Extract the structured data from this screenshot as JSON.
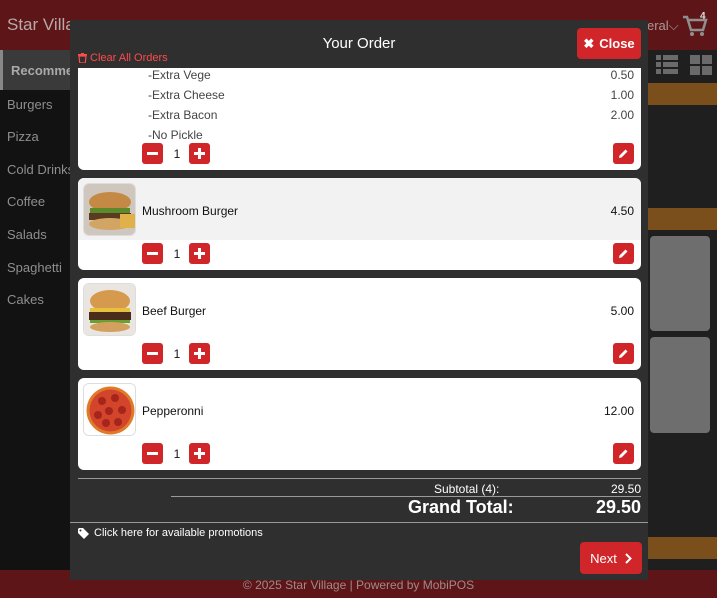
{
  "app": {
    "brand": "Star Villag",
    "lang": "eral",
    "cart_count": "4"
  },
  "sidebar": {
    "items": [
      {
        "label": "Recommen"
      },
      {
        "label": "Burgers"
      },
      {
        "label": "Pizza"
      },
      {
        "label": "Cold Drinks"
      },
      {
        "label": "Coffee"
      },
      {
        "label": "Salads"
      },
      {
        "label": "Spaghetti"
      },
      {
        "label": "Cakes"
      }
    ]
  },
  "footer": {
    "text": "© 2025 Star Village | Powered by MobiPOS"
  },
  "modal": {
    "title": "Your Order",
    "close_label": "Close",
    "clear_all_label": "Clear All Orders",
    "first_item": {
      "extras": [
        {
          "name": "-Extra Vege",
          "price": "0.50"
        },
        {
          "name": "-Extra Cheese",
          "price": "1.00"
        },
        {
          "name": "-Extra Bacon",
          "price": "2.00"
        },
        {
          "name": "-No Pickle",
          "price": ""
        }
      ],
      "qty": "1"
    },
    "items": [
      {
        "name": "Mushroom Burger",
        "price": "4.50",
        "qty": "1",
        "icon": "burger-photo"
      },
      {
        "name": "Beef Burger",
        "price": "5.00",
        "qty": "1",
        "icon": "burger-photo"
      },
      {
        "name": "Pepperonni",
        "price": "12.00",
        "qty": "1",
        "icon": "pizza-photo"
      }
    ],
    "subtotal_label": "Subtotal (4):",
    "subtotal_value": "29.50",
    "grand_total_label": "Grand Total:",
    "grand_total_value": "29.50",
    "promo_label": "Click here for available promotions",
    "next_label": "Next"
  },
  "colors": {
    "accent": "#d0262a",
    "header": "#5e1517",
    "modal_bg": "#2f2f2f"
  }
}
